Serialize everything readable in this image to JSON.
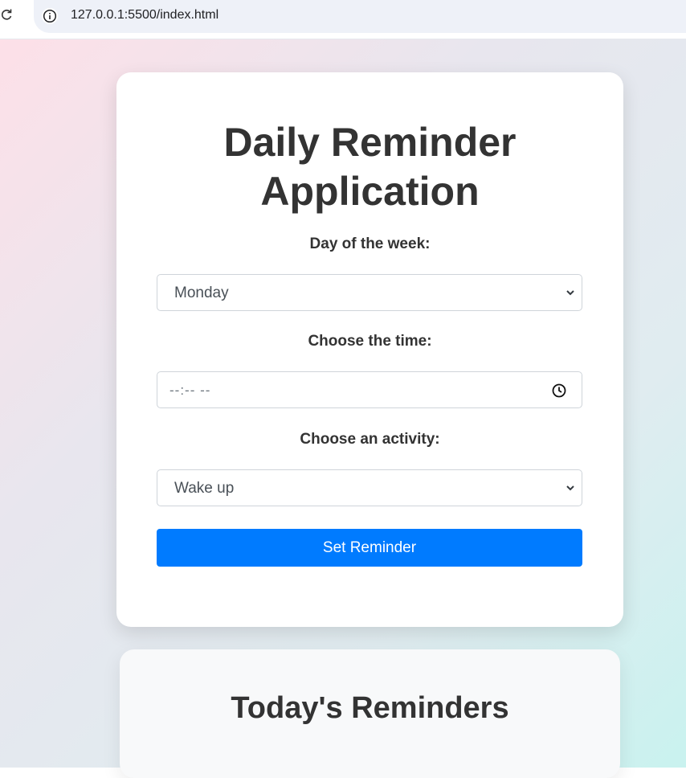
{
  "browser": {
    "url": "127.0.0.1:5500/index.html",
    "reload_icon": "reload-icon",
    "info_icon": "info-icon"
  },
  "app": {
    "title_line1": "Daily Reminder",
    "title_line2": "Application",
    "day_label": "Day of the week:",
    "day_value": "Monday",
    "time_label": "Choose the time:",
    "time_value": "--:-- --",
    "activity_label": "Choose an activity:",
    "activity_value": "Wake up",
    "submit_label": "Set Reminder"
  },
  "reminders": {
    "title": "Today's Reminders"
  },
  "colors": {
    "primary": "#007bff",
    "text": "#333333"
  }
}
